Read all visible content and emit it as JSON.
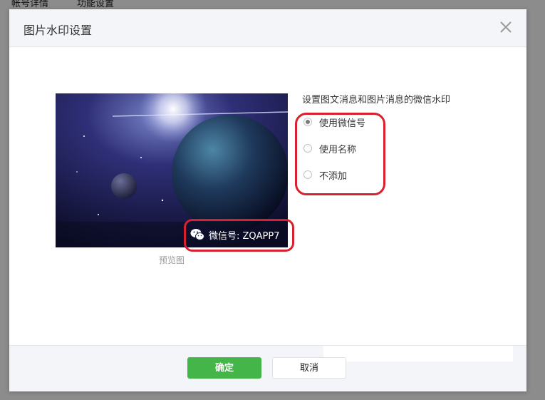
{
  "background": {
    "tabs": [
      "帐号详情",
      "功能设置"
    ]
  },
  "dialog": {
    "title": "图片水印设置",
    "close_icon": "close-icon"
  },
  "preview": {
    "watermark_icon": "wechat-icon",
    "watermark_text": "微信号: ZQAPP7",
    "caption": "预览图"
  },
  "options": {
    "title": "设置图文消息和图片消息的微信水印",
    "items": [
      {
        "label": "使用微信号",
        "checked": true
      },
      {
        "label": "使用名称",
        "checked": false
      },
      {
        "label": "不添加",
        "checked": false
      }
    ]
  },
  "footer": {
    "confirm_label": "确定",
    "cancel_label": "取消"
  },
  "colors": {
    "accent": "#44b549",
    "annotation": "#d8212f"
  }
}
